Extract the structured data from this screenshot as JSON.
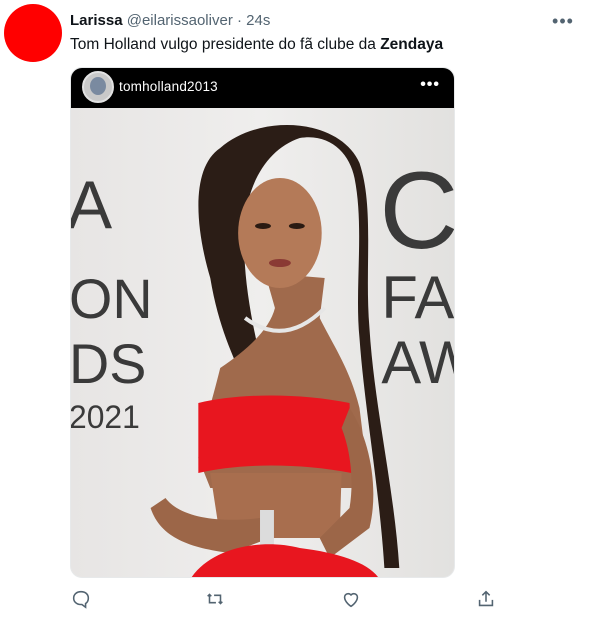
{
  "tweet": {
    "author_name": "Larissa",
    "author_handle": "@eilarissaoliver",
    "separator": "·",
    "time": "24s",
    "text_prefix": "Tom Holland vulgo presidente do fã clube da ",
    "text_bold": "Zendaya",
    "avatar_color": "#ff0000"
  },
  "embedded_post": {
    "username": "tomholland2013",
    "menu_glyph": "•••",
    "backdrop_lines_left": [
      "A",
      "ON",
      "DS",
      "2021"
    ],
    "backdrop_lines_right": [
      "C",
      "FA",
      "AW"
    ]
  },
  "colors": {
    "text_primary": "#0f1419",
    "text_secondary": "#536471",
    "dress_red": "#e8161f"
  },
  "action_icons": [
    "reply-icon",
    "retweet-icon",
    "like-icon",
    "share-icon"
  ]
}
